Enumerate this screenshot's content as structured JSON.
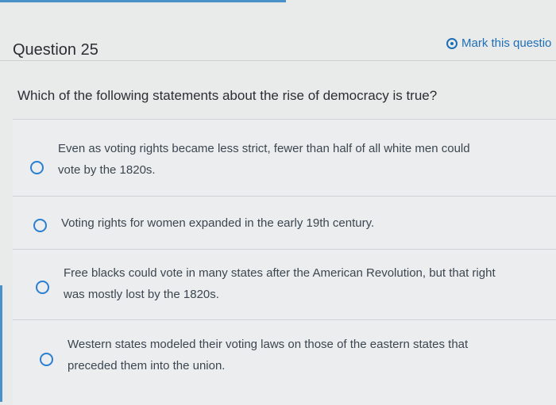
{
  "question": {
    "title": "Question 25",
    "mark_label": "Mark this questio",
    "prompt": "Which of the following statements about the rise of democracy is true?"
  },
  "answers": [
    {
      "line1": "Even as voting rights became less strict, fewer than half of all white men could",
      "line2": "vote by the 1820s."
    },
    {
      "line1": "Voting rights for women expanded in the early 19th century.",
      "line2": ""
    },
    {
      "line1": "Free blacks could vote in many states after the American Revolution, but that right",
      "line2": "was mostly lost by the 1820s."
    },
    {
      "line1": "Western states modeled their voting laws on those of the eastern states that",
      "line2": "preceded them into the union."
    }
  ],
  "colors": {
    "accent": "#1f6fb7",
    "radio": "#2a7fd0",
    "background": "#e9eaea"
  }
}
